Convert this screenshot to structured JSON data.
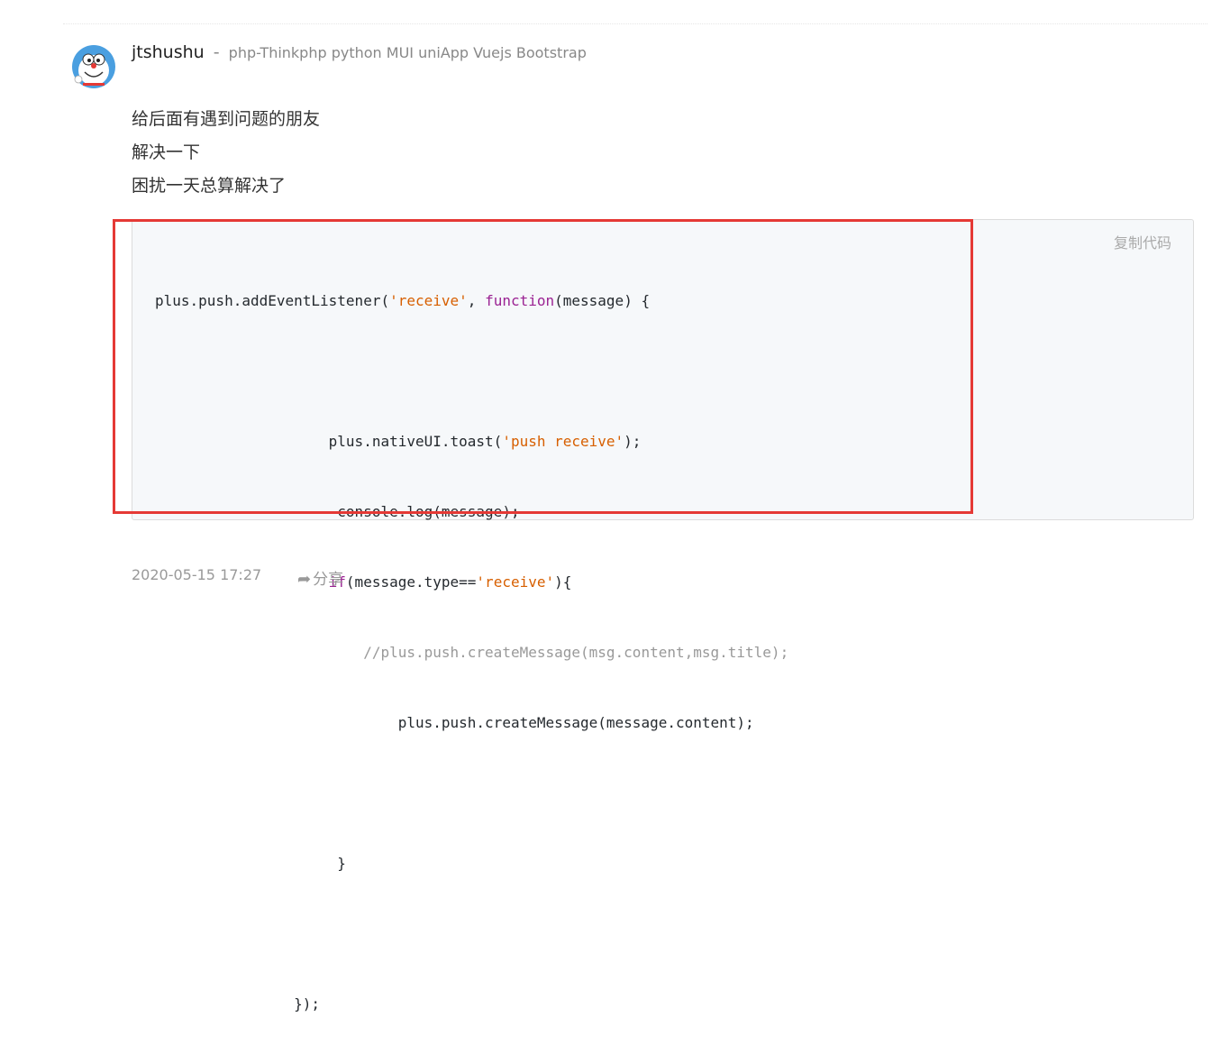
{
  "author": {
    "name": "jtshushu",
    "separator": "-",
    "bio": "php-Thinkphp python MUI uniApp Vuejs Bootstrap"
  },
  "post": {
    "lines": [
      "给后面有遇到问题的朋友",
      "解决一下",
      "困扰一天总算解决了"
    ]
  },
  "code_block": {
    "copy_label": "复制代码",
    "l1_a": "plus.push.addEventListener(",
    "l1_str": "'receive'",
    "l1_b": ", ",
    "l1_kw": "function",
    "l1_c": "(message) {",
    "l3_a": "                    plus.nativeUI.toast(",
    "l3_str": "'push receive'",
    "l3_b": ");",
    "l4": "                     console.log(message);",
    "l5_pre": "                    ",
    "l5_kw": "if",
    "l5_a": "(message.type==",
    "l5_str": "'receive'",
    "l5_b": "){",
    "l6": "                        //plus.push.createMessage(msg.content,msg.title);",
    "l7": "                            plus.push.createMessage(message.content);",
    "l9": "                     }",
    "l11": "                });"
  },
  "footer": {
    "timestamp": "2020-05-15 17:27",
    "share_icon": "share-arrow-icon",
    "share_label": "分享"
  },
  "colors": {
    "highlight_border": "#e53935",
    "code_string": "#d75f00",
    "code_keyword": "#9b2393",
    "code_comment": "#999999"
  }
}
